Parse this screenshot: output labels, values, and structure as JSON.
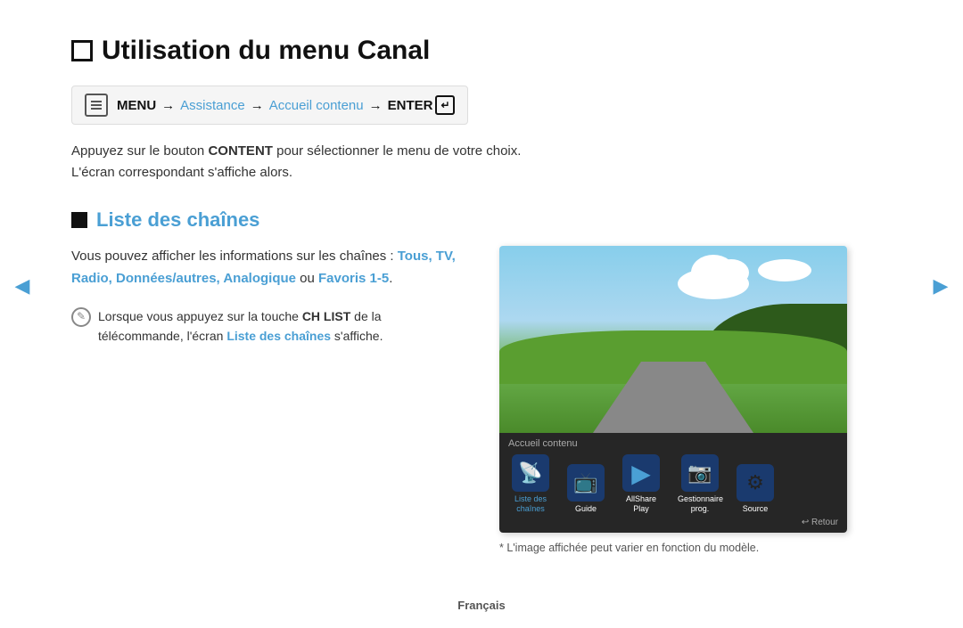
{
  "page": {
    "title": "Utilisation du menu Canal",
    "title_checkbox": "☐"
  },
  "breadcrumb": {
    "menu_label": "MENU",
    "arrow1": "→",
    "assistance": "Assistance",
    "arrow2": "→",
    "accueil": "Accueil contenu",
    "arrow3": "→",
    "enter": "ENTER"
  },
  "description": {
    "text1": "Appuyez sur le bouton ",
    "bold": "CONTENT",
    "text2": " pour sélectionner le menu de votre choix.",
    "line2": "L'écran correspondant s'affiche alors."
  },
  "section": {
    "heading": "Liste des chaînes",
    "channel_desc_part1": "Vous pouvez afficher les informations sur les chaînes : ",
    "channel_desc_links": "Tous, TV, Radio, Données/autres, Analogique",
    "channel_desc_part2": " ou ",
    "channel_desc_fav": "Favoris 1-5",
    "channel_desc_end": ".",
    "note_part1": "Lorsque vous appuyez sur la touche ",
    "note_bold": "CH LIST",
    "note_part2": " de la télécommande, l'écran ",
    "note_link": "Liste des chaînes",
    "note_part3": " s'affiche."
  },
  "tv_screen": {
    "label": "Accueil contenu",
    "menu_items": [
      {
        "label": "Liste des chaînes",
        "active": true,
        "icon": "📡"
      },
      {
        "label": "Guide",
        "active": false,
        "icon": "📺"
      },
      {
        "label": "AllShare Play",
        "active": false,
        "icon": "▶"
      },
      {
        "label": "Gestionnaire prog.",
        "active": false,
        "icon": "📷"
      },
      {
        "label": "Source",
        "active": false,
        "icon": "⚙"
      }
    ],
    "retour": "↩ Retour"
  },
  "caption": "* L'image affichée peut varier en fonction du modèle.",
  "footer": "Français",
  "nav": {
    "left_arrow": "◀",
    "right_arrow": "▶"
  }
}
